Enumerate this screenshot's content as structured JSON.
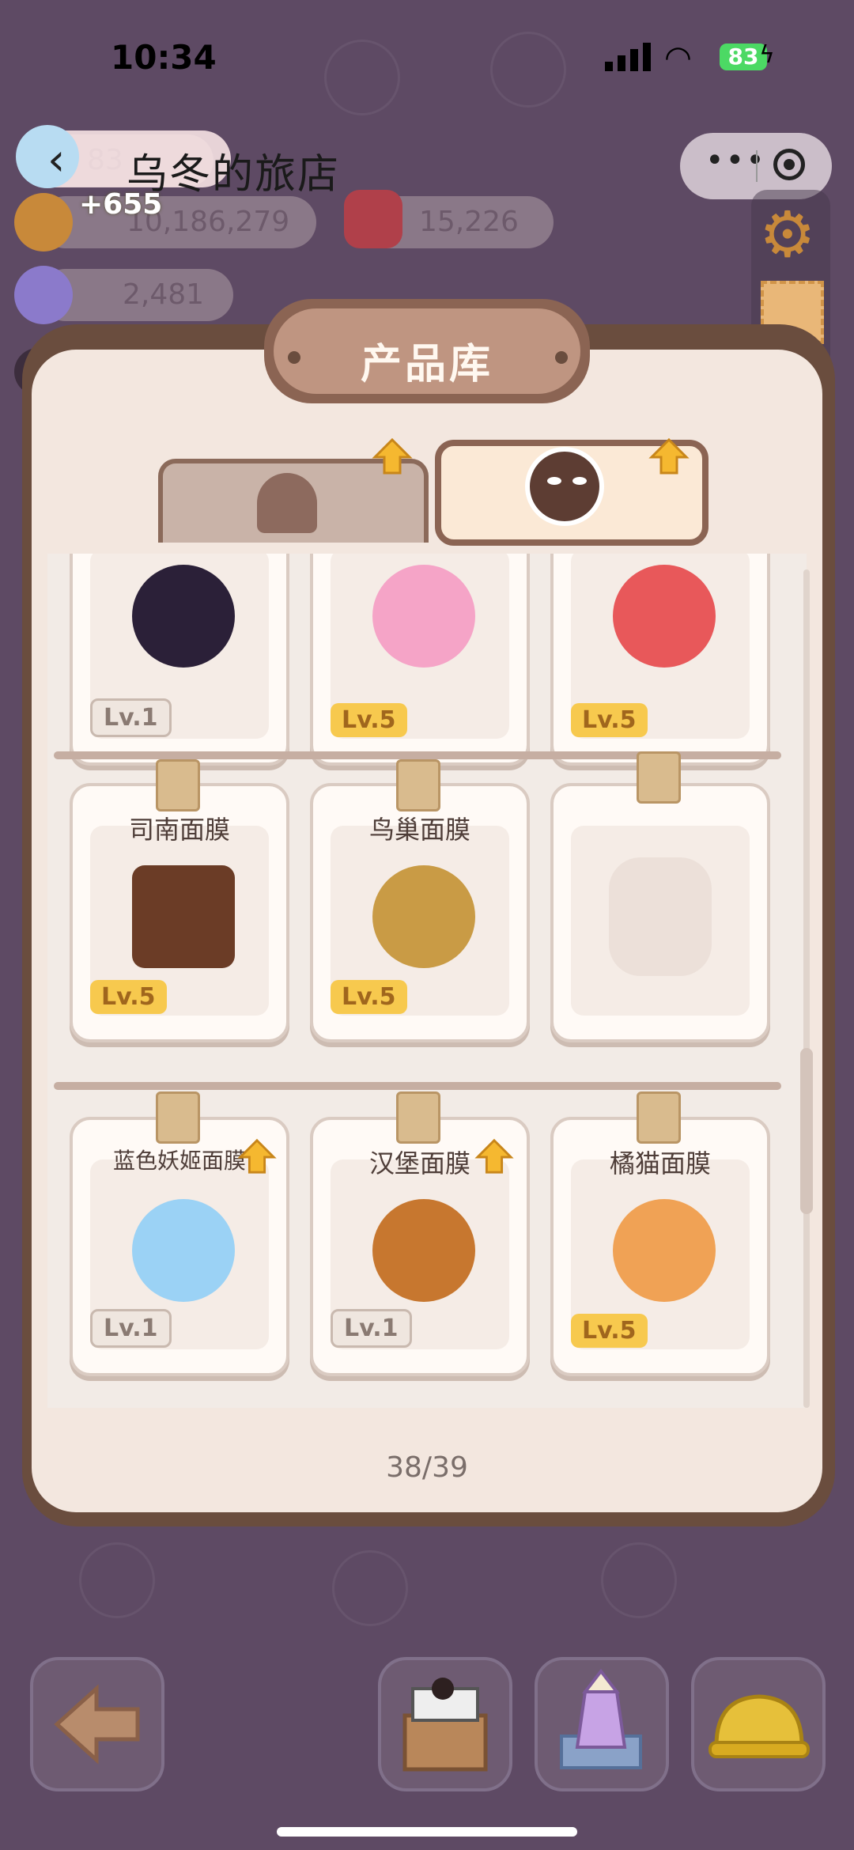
{
  "status_bar": {
    "time": "10:34",
    "battery": "83"
  },
  "header": {
    "title": "乌冬的旅店",
    "back_label": "‹",
    "resources": {
      "gems_partial": "83",
      "gain": "+655",
      "coins": "10,186,279",
      "jam": "15,226",
      "crystal": "2,481"
    }
  },
  "panel": {
    "title": "产品库",
    "tabs": [
      {
        "name": "hair",
        "active": false
      },
      {
        "name": "mask",
        "active": true
      }
    ],
    "rows": [
      {
        "items": [
          {
            "name": "",
            "level": "Lv.1",
            "gold": false,
            "color": "#2b2038"
          },
          {
            "name": "",
            "level": "Lv.5",
            "gold": true,
            "color": "#f5a4c7"
          },
          {
            "name": "",
            "level": "Lv.5",
            "gold": true,
            "color": "#e8585a"
          }
        ]
      },
      {
        "items": [
          {
            "name": "司南面膜",
            "level": "Lv.5",
            "gold": true,
            "color": "#6b3c26"
          },
          {
            "name": "鸟巢面膜",
            "level": "Lv.5",
            "gold": true,
            "color": "#c99b45"
          },
          {
            "name": "",
            "level": "",
            "gold": false,
            "color": "#ece0d9"
          }
        ]
      },
      {
        "items": [
          {
            "name": "蓝色妖姬面膜",
            "level": "Lv.1",
            "gold": false,
            "color": "#9bd2f5"
          },
          {
            "name": "汉堡面膜",
            "level": "Lv.1",
            "gold": false,
            "color": "#c7772f"
          },
          {
            "name": "橘猫面膜",
            "level": "Lv.5",
            "gold": true,
            "color": "#f0a255"
          }
        ]
      }
    ],
    "page_indicator": "38/39"
  },
  "colors": {
    "accent": "#f5b830",
    "frame": "#6a4d3e"
  }
}
